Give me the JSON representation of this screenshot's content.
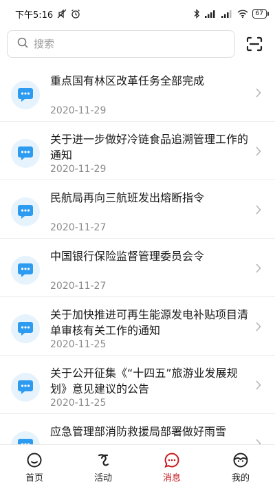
{
  "status_bar": {
    "time": "下午5:16",
    "battery": "67"
  },
  "search": {
    "placeholder": "搜索"
  },
  "messages": [
    {
      "title": "重点国有林区改革任务全部完成",
      "date": "2020-11-29"
    },
    {
      "title": " 关于进一步做好冷链食品追溯管理工作的通知",
      "date": "2020-11-29"
    },
    {
      "title": "民航局再向三航班发出熔断指令",
      "date": "2020-11-27"
    },
    {
      "title": "中国银行保险监督管理委员会令",
      "date": "2020-11-27"
    },
    {
      "title": "关于加快推进可再生能源发电补贴项目清单审核有关工作的通知",
      "date": "2020-11-25"
    },
    {
      "title": " 关于公开征集《“十四五”旅游业发展规划》意见建议的公告",
      "date": "2020-11-25"
    },
    {
      "title": "应急管理部消防救援局部署做好雨雪",
      "date": ""
    }
  ],
  "tabs": [
    {
      "label": "首页",
      "icon": "home-face-icon"
    },
    {
      "label": "活动",
      "icon": "activity-icon"
    },
    {
      "label": "消息",
      "icon": "message-icon",
      "active": true
    },
    {
      "label": "我的",
      "icon": "profile-face-icon"
    }
  ],
  "colors": {
    "accent": "#c6191f",
    "message_icon": "#2d9bf0",
    "message_icon_bg": "#e6f3fd"
  }
}
